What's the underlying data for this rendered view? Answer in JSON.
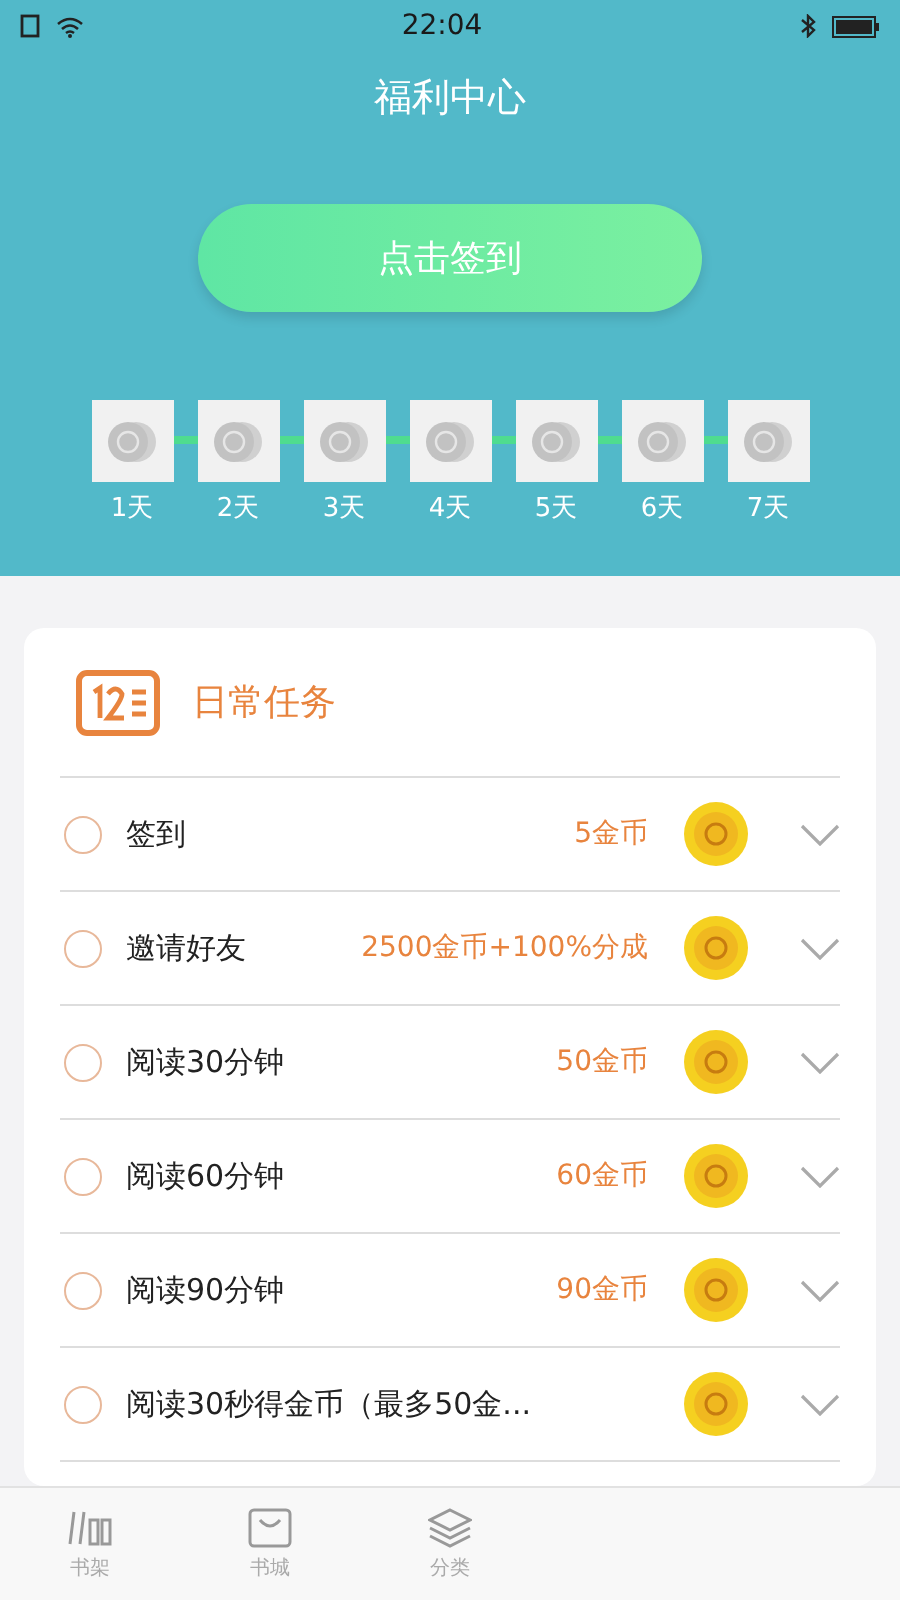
{
  "status_bar": {
    "time": "22:04"
  },
  "header": {
    "title": "福利中心",
    "sign_button": "点击签到"
  },
  "days": [
    {
      "label": "1天",
      "signed": false
    },
    {
      "label": "2天",
      "signed": false
    },
    {
      "label": "3天",
      "signed": false
    },
    {
      "label": "4天",
      "signed": false
    },
    {
      "label": "5天",
      "signed": false
    },
    {
      "label": "6天",
      "signed": false
    },
    {
      "label": "7天",
      "signed": false
    }
  ],
  "daily_tasks": {
    "title": "日常任务",
    "tasks": [
      {
        "name": "签到",
        "reward": "5金币",
        "checked": false
      },
      {
        "name": "邀请好友",
        "reward": "2500金币+100%分成",
        "checked": false
      },
      {
        "name": "阅读30分钟",
        "reward": "50金币",
        "checked": false
      },
      {
        "name": "阅读60分钟",
        "reward": "60金币",
        "checked": false
      },
      {
        "name": "阅读90分钟",
        "reward": "90金币",
        "checked": false
      },
      {
        "name": "阅读30秒得金币（最多50金...",
        "checked": false
      }
    ]
  },
  "tab_bar": [
    {
      "label": "书架",
      "kind": "shelf",
      "selected": false
    },
    {
      "label": "书城",
      "kind": "store",
      "selected": false
    },
    {
      "label": "分类",
      "kind": "category",
      "selected": false
    }
  ]
}
